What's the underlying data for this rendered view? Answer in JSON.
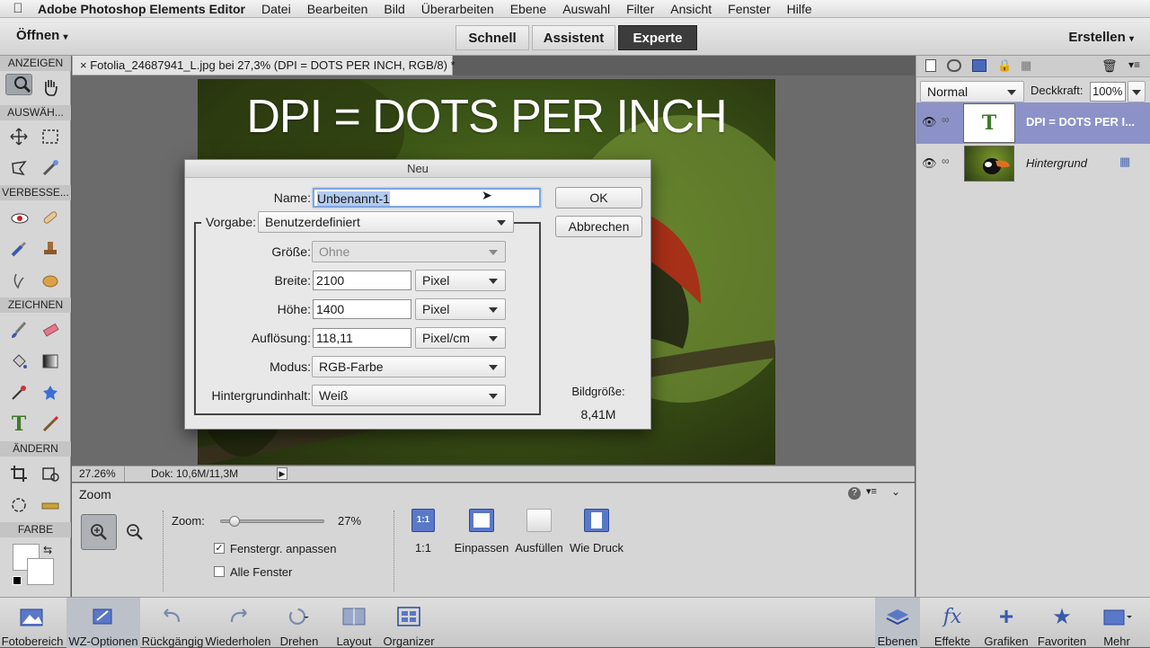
{
  "menubar": {
    "app_name": "Adobe Photoshop Elements Editor",
    "items": [
      "Datei",
      "Bearbeiten",
      "Bild",
      "Überarbeiten",
      "Ebene",
      "Auswahl",
      "Filter",
      "Ansicht",
      "Fenster",
      "Hilfe"
    ]
  },
  "appbar": {
    "open_label": "Öffnen",
    "modes": [
      "Schnell",
      "Assistent",
      "Experte"
    ],
    "active_mode": "Experte",
    "create_label": "Erstellen"
  },
  "toolbox": {
    "sections": [
      "ANZEIGEN",
      "AUSWÄH...",
      "VERBESSE...",
      "ZEICHNEN",
      "ÄNDERN",
      "FARBE"
    ]
  },
  "document": {
    "tab_close": "×",
    "tab_title": "Fotolia_24687941_L.jpg bei 27,3% (DPI = DOTS PER INCH, RGB/8) *",
    "image_text": "DPI = DOTS PER INCH",
    "zoom_readout": "27.26%",
    "doc_info": "Dok: 10,6M/11,3M"
  },
  "dialog": {
    "title": "Neu",
    "name_label": "Name:",
    "name_value": "Unbenannt-1",
    "preset_label": "Vorgabe:",
    "preset_value": "Benutzerdefiniert",
    "size_label": "Größe:",
    "size_value": "Ohne",
    "width_label": "Breite:",
    "width_value": "2100",
    "width_unit": "Pixel",
    "height_label": "Höhe:",
    "height_value": "1400",
    "height_unit": "Pixel",
    "res_label": "Auflösung:",
    "res_value": "118,11",
    "res_unit": "Pixel/cm",
    "mode_label": "Modus:",
    "mode_value": "RGB-Farbe",
    "bg_label": "Hintergrundinhalt:",
    "bg_value": "Weiß",
    "ok_label": "OK",
    "cancel_label": "Abbrechen",
    "imgsize_label": "Bildgröße:",
    "imgsize_value": "8,41M"
  },
  "zoom_panel": {
    "title": "Zoom",
    "zoom_label": "Zoom:",
    "zoom_value": "27%",
    "zoom_level": 0.27,
    "fit_window_label": "Fenstergr. anpassen",
    "fit_window_checked": true,
    "all_windows_label": "Alle Fenster",
    "all_windows_checked": false,
    "buttons": [
      "1:1",
      "Einpassen",
      "Ausfüllen",
      "Wie Druck"
    ],
    "one_to_one_icon": "1:1"
  },
  "layers_panel": {
    "blend_mode": "Normal",
    "opacity_label": "Deckkraft:",
    "opacity_value": "100%",
    "layers": [
      {
        "name": "DPI = DOTS PER I...",
        "type": "text",
        "selected": true,
        "thumb": "T"
      },
      {
        "name": "Hintergrund",
        "type": "image",
        "selected": false
      }
    ]
  },
  "taskbar": {
    "left": [
      "Fotobereich",
      "WZ-Optionen",
      "Rückgängig",
      "Wiederholen",
      "Drehen",
      "Layout",
      "Organizer"
    ],
    "right": [
      "Ebenen",
      "Effekte",
      "Grafiken",
      "Favoriten",
      "Mehr"
    ]
  },
  "colors": {
    "selected_layer": "#8c92c8",
    "accent": "#3a5aa8"
  }
}
